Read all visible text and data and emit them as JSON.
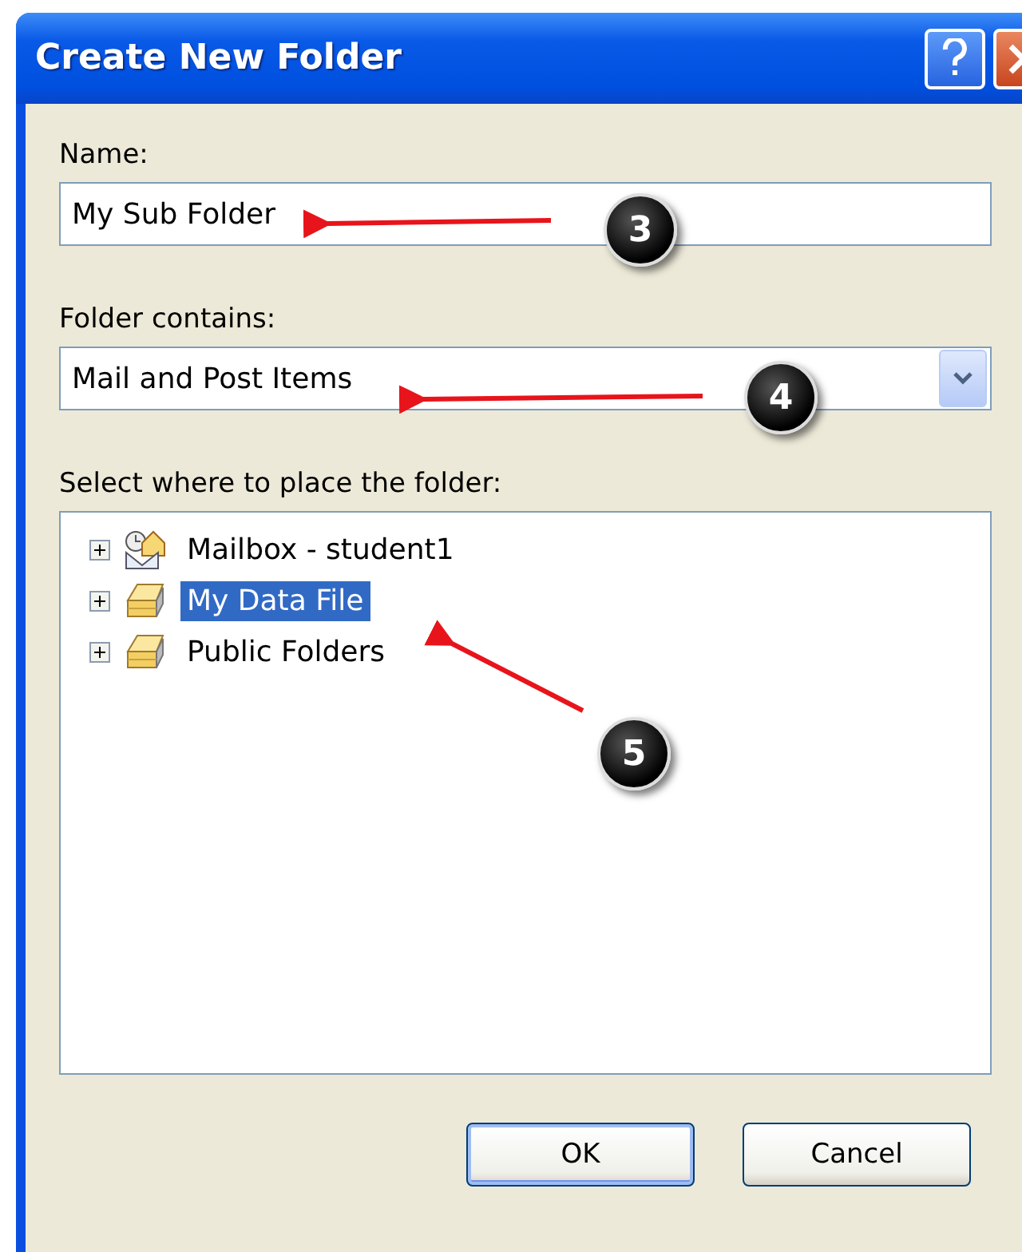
{
  "window": {
    "title": "Create New Folder"
  },
  "name_field": {
    "label": "Name:",
    "value": "My Sub Folder"
  },
  "contains_field": {
    "label": "Folder contains:",
    "value": "Mail and Post Items"
  },
  "tree": {
    "label": "Select where to place the folder:",
    "items": [
      {
        "label": "Mailbox - student1",
        "kind": "mailbox",
        "expanded": false,
        "selected": false
      },
      {
        "label": "My Data File",
        "kind": "datafile",
        "expanded": false,
        "selected": true
      },
      {
        "label": "Public Folders",
        "kind": "datafile",
        "expanded": false,
        "selected": false
      }
    ]
  },
  "buttons": [
    {
      "label": "OK",
      "kind": "default"
    },
    {
      "label": "Cancel",
      "kind": "normal"
    }
  ],
  "callouts": [
    "3",
    "4",
    "5"
  ]
}
